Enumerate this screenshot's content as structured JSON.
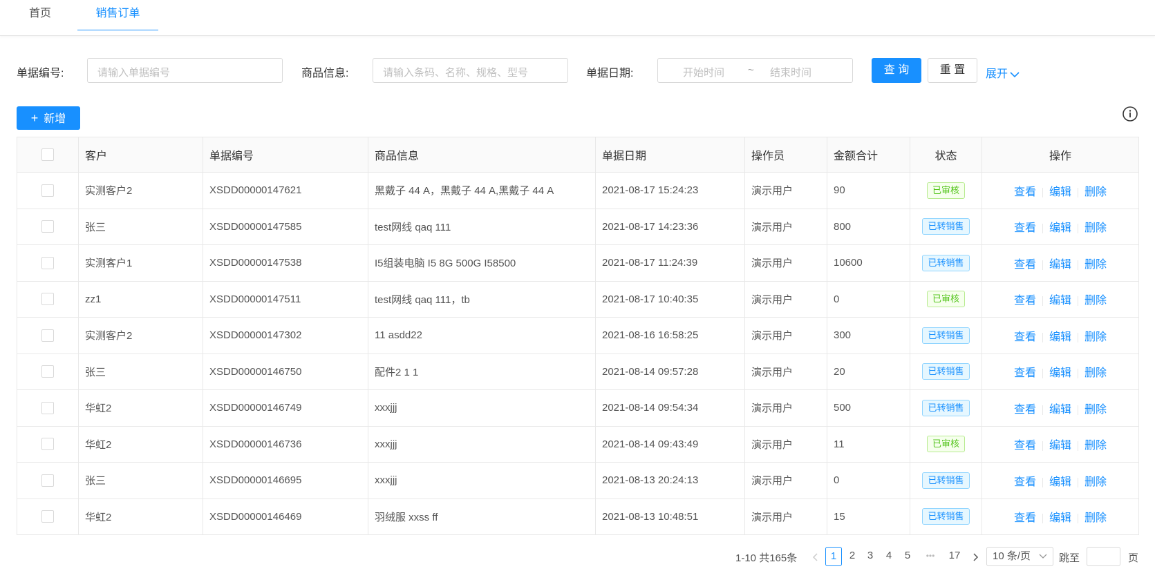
{
  "tabs": {
    "home": "首页",
    "active": "销售订单"
  },
  "search": {
    "order_no_label": "单据编号:",
    "order_no_placeholder": "请输入单据编号",
    "product_label": "商品信息:",
    "product_placeholder": "请输入条码、名称、规格、型号",
    "date_label": "单据日期:",
    "start_placeholder": "开始时间",
    "tilde": "~",
    "end_placeholder": "结束时间",
    "query_label": "查 询",
    "reset_label": "重 置",
    "expand_label": "展开"
  },
  "toolbar": {
    "add_label": "新增"
  },
  "table": {
    "headers": [
      "客户",
      "单据编号",
      "商品信息",
      "单据日期",
      "操作员",
      "金额合计",
      "状态",
      "操作"
    ],
    "actions": {
      "view": "查看",
      "edit": "编辑",
      "delete": "删除"
    },
    "rows": [
      {
        "customer": "实测客户2",
        "order_no": "XSDD00000147621",
        "product": "黑戴子 44 A，黑戴子 44 A,黑戴子 44 A",
        "date": "2021-08-17 15:24:23",
        "operator": "演示用户",
        "amount": "90",
        "status": "已审核",
        "status_color": "#52c41a"
      },
      {
        "customer": "张三",
        "order_no": "XSDD00000147585",
        "product": "test网线 qaq 111",
        "date": "2021-08-17 14:23:36",
        "operator": "演示用户",
        "amount": "800",
        "status": "已转销售",
        "status_color": "#1890ff"
      },
      {
        "customer": "实测客户1",
        "order_no": "XSDD00000147538",
        "product": "I5组装电脑 I5 8G 500G I58500",
        "date": "2021-08-17 11:24:39",
        "operator": "演示用户",
        "amount": "10600",
        "status": "已转销售",
        "status_color": "#1890ff"
      },
      {
        "customer": "zz1",
        "order_no": "XSDD00000147511",
        "product": "test网线 qaq 111，tb",
        "date": "2021-08-17 10:40:35",
        "operator": "演示用户",
        "amount": "0",
        "status": "已审核",
        "status_color": "#52c41a"
      },
      {
        "customer": "实测客户2",
        "order_no": "XSDD00000147302",
        "product": "11 asdd22",
        "date": "2021-08-16 16:58:25",
        "operator": "演示用户",
        "amount": "300",
        "status": "已转销售",
        "status_color": "#1890ff"
      },
      {
        "customer": "张三",
        "order_no": "XSDD00000146750",
        "product": "配件2 1 1",
        "date": "2021-08-14 09:57:28",
        "operator": "演示用户",
        "amount": "20",
        "status": "已转销售",
        "status_color": "#1890ff"
      },
      {
        "customer": "华虹2",
        "order_no": "XSDD00000146749",
        "product": "xxxjjj",
        "date": "2021-08-14 09:54:34",
        "operator": "演示用户",
        "amount": "500",
        "status": "已转销售",
        "status_color": "#1890ff"
      },
      {
        "customer": "华虹2",
        "order_no": "XSDD00000146736",
        "product": "xxxjjj",
        "date": "2021-08-14 09:43:49",
        "operator": "演示用户",
        "amount": "11",
        "status": "已审核",
        "status_color": "#52c41a"
      },
      {
        "customer": "张三",
        "order_no": "XSDD00000146695",
        "product": "xxxjjj",
        "date": "2021-08-13 20:24:13",
        "operator": "演示用户",
        "amount": "0",
        "status": "已转销售",
        "status_color": "#1890ff"
      },
      {
        "customer": "华虹2",
        "order_no": "XSDD00000146469",
        "product": "羽绒服 xxss ff",
        "date": "2021-08-13 10:48:51",
        "operator": "演示用户",
        "amount": "15",
        "status": "已转销售",
        "status_color": "#1890ff"
      }
    ]
  },
  "pagination": {
    "summary": "1-10 共165条",
    "prev_icon": "chevron-left-icon",
    "pages": [
      "1",
      "2",
      "3",
      "4",
      "5"
    ],
    "current": "1",
    "ellipsis": "•••",
    "last": "17",
    "next_icon": "chevron-right-icon",
    "page_size": "10 条/页",
    "jump_label": "跳至",
    "page_suffix": "页"
  },
  "icons": {
    "info": "info-circle-icon",
    "expand": "chevron-down-icon",
    "add": "plus-icon"
  },
  "colors": {
    "primary": "#1890ff",
    "success": "#52c41a"
  }
}
